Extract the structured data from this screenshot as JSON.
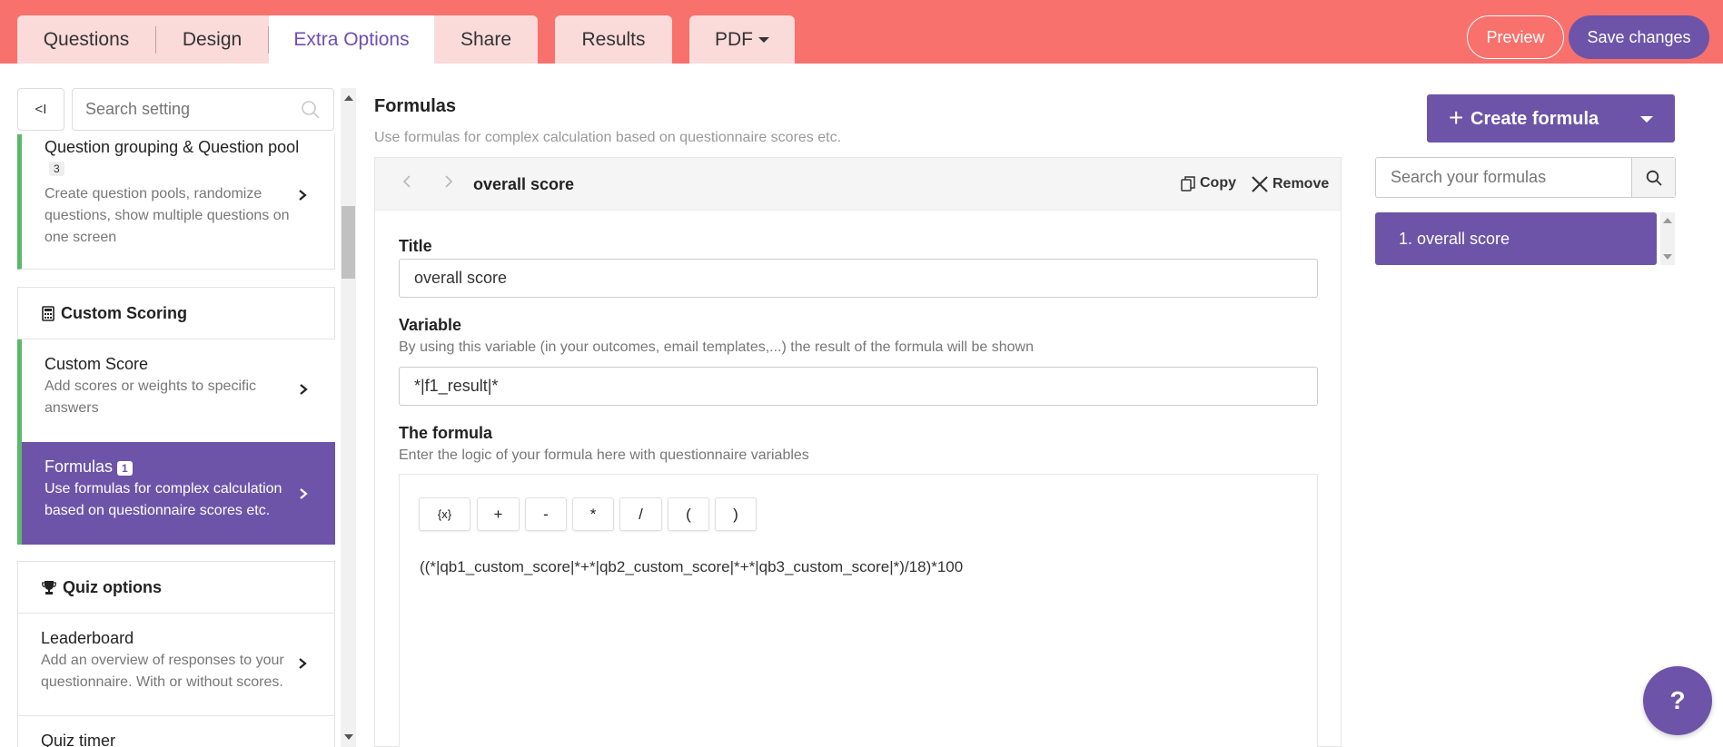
{
  "tabs": {
    "questions": "Questions",
    "design": "Design",
    "extra_options": "Extra Options",
    "share": "Share",
    "results": "Results",
    "pdf": "PDF"
  },
  "header_actions": {
    "preview": "Preview",
    "save": "Save changes"
  },
  "sidebar": {
    "collapse_label": "<I",
    "search_placeholder": "Search setting",
    "question_grouping": {
      "title": "Question grouping & Question pool",
      "badge": "3",
      "description": "Create question pools, randomize questions, show multiple questions on one screen"
    },
    "custom_scoring": {
      "heading": "Custom Scoring",
      "custom_score": {
        "title": "Custom Score",
        "description": "Add scores or weights to specific answers"
      },
      "formulas": {
        "title": "Formulas",
        "badge": "1",
        "description": "Use formulas for complex calculation based on questionnaire scores etc."
      }
    },
    "quiz_options": {
      "heading": "Quiz options",
      "leaderboard": {
        "title": "Leaderboard",
        "description": "Add an overview of responses to your questionnaire. With or without scores."
      },
      "quiz_timer": {
        "title": "Quiz timer"
      }
    }
  },
  "main": {
    "title": "Formulas",
    "subtitle": "Use formulas for complex calculation based on questionnaire scores etc.",
    "editor": {
      "name": "overall score",
      "copy_label": "Copy",
      "remove_label": "Remove",
      "title_label": "Title",
      "title_value": "overall score",
      "variable_label": "Variable",
      "variable_help": "By using this variable (in your outcomes, email templates,...) the result of the formula will be shown",
      "variable_value": "*|f1_result|*",
      "formula_label": "The formula",
      "formula_help": "Enter the logic of your formula here with questionnaire variables",
      "operators": [
        "{x}",
        "+",
        "-",
        "*",
        "/",
        "(",
        ")"
      ],
      "formula_value": "((*|qb1_custom_score|*+*|qb2_custom_score|*+*|qb3_custom_score|*)/18)*100"
    }
  },
  "right": {
    "create_label": "Create formula",
    "search_placeholder": "Search your formulas",
    "formulas": [
      {
        "label": "1. overall score"
      }
    ]
  },
  "help": {
    "label": "?"
  },
  "colors": {
    "topbar": "#f8716c",
    "tab_bg": "#fbdada",
    "accent": "#6d54a8",
    "green_marker": "#5cb86b"
  }
}
